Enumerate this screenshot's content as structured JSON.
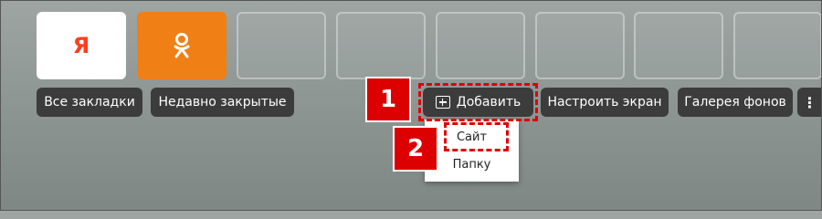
{
  "tiles": [
    {
      "name": "yandex-tile",
      "icon": "yandex-logo-icon",
      "logo_text": "Я"
    },
    {
      "name": "odnoklassniki-tile",
      "icon": "odnoklassniki-logo-icon",
      "logo_text": "ок"
    }
  ],
  "toolbar": {
    "all_bookmarks": "Все закладки",
    "recently_closed": "Недавно закрытые",
    "add": "Добавить",
    "customize_screen": "Настроить экран",
    "backgrounds_gallery": "Галерея фонов",
    "more": "⋮"
  },
  "add_menu": {
    "site": "Сайт",
    "folder": "Папку"
  },
  "annotations": {
    "step1": "1",
    "step2": "2"
  },
  "colors": {
    "highlight": "#e00000",
    "button_bg": "#3c3c3c",
    "ok_orange": "#f07f15",
    "yandex_red": "#fc3f1d"
  }
}
